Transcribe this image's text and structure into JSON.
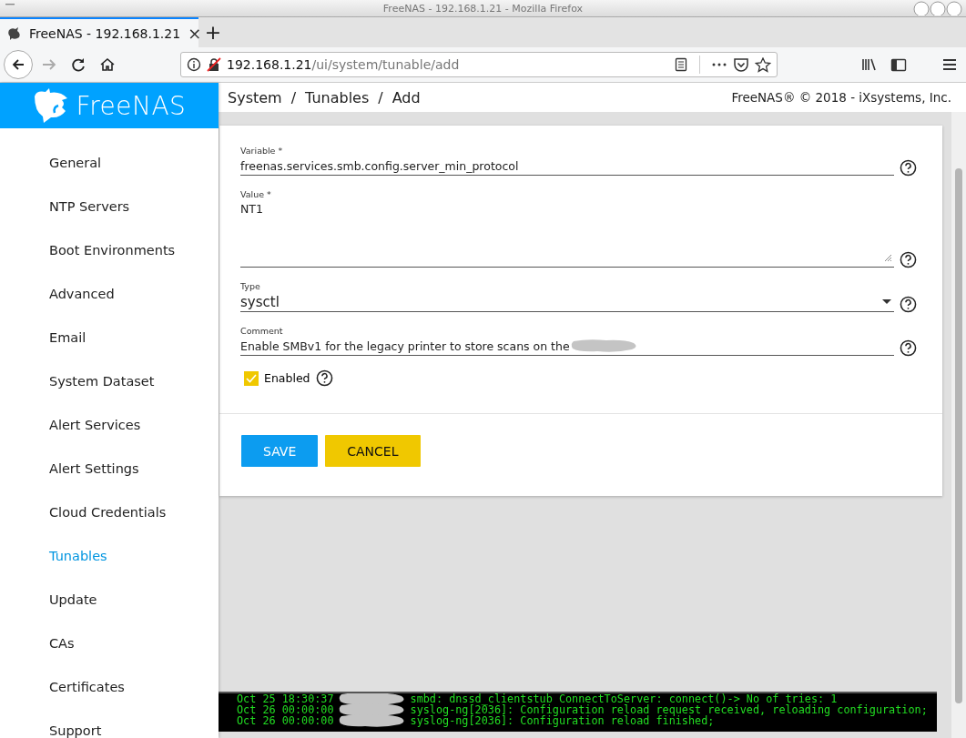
{
  "window": {
    "title": "FreeNAS - 192.168.1.21 - Mozilla Firefox"
  },
  "browser": {
    "tab": {
      "title": "FreeNAS - 192.168.1.21",
      "close": "×",
      "selected": true
    },
    "new_tab": "+",
    "url_host": "192.168.1.21",
    "url_path": "/ui/system/tunable/add"
  },
  "sidebar": {
    "logo": "FreeNAS",
    "items": [
      {
        "label": "General",
        "selected": false
      },
      {
        "label": "NTP Servers",
        "selected": false
      },
      {
        "label": "Boot Environments",
        "selected": false
      },
      {
        "label": "Advanced",
        "selected": false
      },
      {
        "label": "Email",
        "selected": false
      },
      {
        "label": "System Dataset",
        "selected": false
      },
      {
        "label": "Alert Services",
        "selected": false
      },
      {
        "label": "Alert Settings",
        "selected": false
      },
      {
        "label": "Cloud Credentials",
        "selected": false
      },
      {
        "label": "Tunables",
        "selected": true
      },
      {
        "label": "Update",
        "selected": false
      },
      {
        "label": "CAs",
        "selected": false
      },
      {
        "label": "Certificates",
        "selected": false
      },
      {
        "label": "Support",
        "selected": false
      }
    ]
  },
  "header": {
    "breadcrumb": [
      "System",
      "Tunables",
      "Add"
    ],
    "separators": [
      "/",
      "/"
    ],
    "copyright": "FreeNAS® © 2018 - iXsystems, Inc."
  },
  "form": {
    "fields": [
      {
        "kind": "input",
        "label": "Variable *",
        "value": "freenas.services.smb.config.server_min_protocol"
      },
      {
        "kind": "textarea",
        "label": "Value *",
        "value": "NT1"
      },
      {
        "kind": "select",
        "label": "Type",
        "value": "sysctl"
      },
      {
        "kind": "input",
        "label": "Comment",
        "value": "Enable SMBv1 for the legacy printer to store scans on the",
        "redacted": true
      }
    ],
    "enabled": {
      "label": "Enabled",
      "checked": true
    },
    "buttons": [
      {
        "label": "SAVE",
        "kind": "primary"
      },
      {
        "label": "CANCEL",
        "kind": "warn"
      }
    ]
  },
  "console": {
    "lines": [
      {
        "time": "Oct 25 18:30:37",
        "message": "smbd: dnssd_clientstub ConnectToServer: connect()-> No of tries: 1"
      },
      {
        "time": "Oct 26 00:00:00",
        "message": "syslog-ng[2036]: Configuration reload request received, reloading configuration;"
      },
      {
        "time": "Oct 26 00:00:00",
        "message": "syslog-ng[2036]: Configuration reload finished;"
      }
    ]
  }
}
